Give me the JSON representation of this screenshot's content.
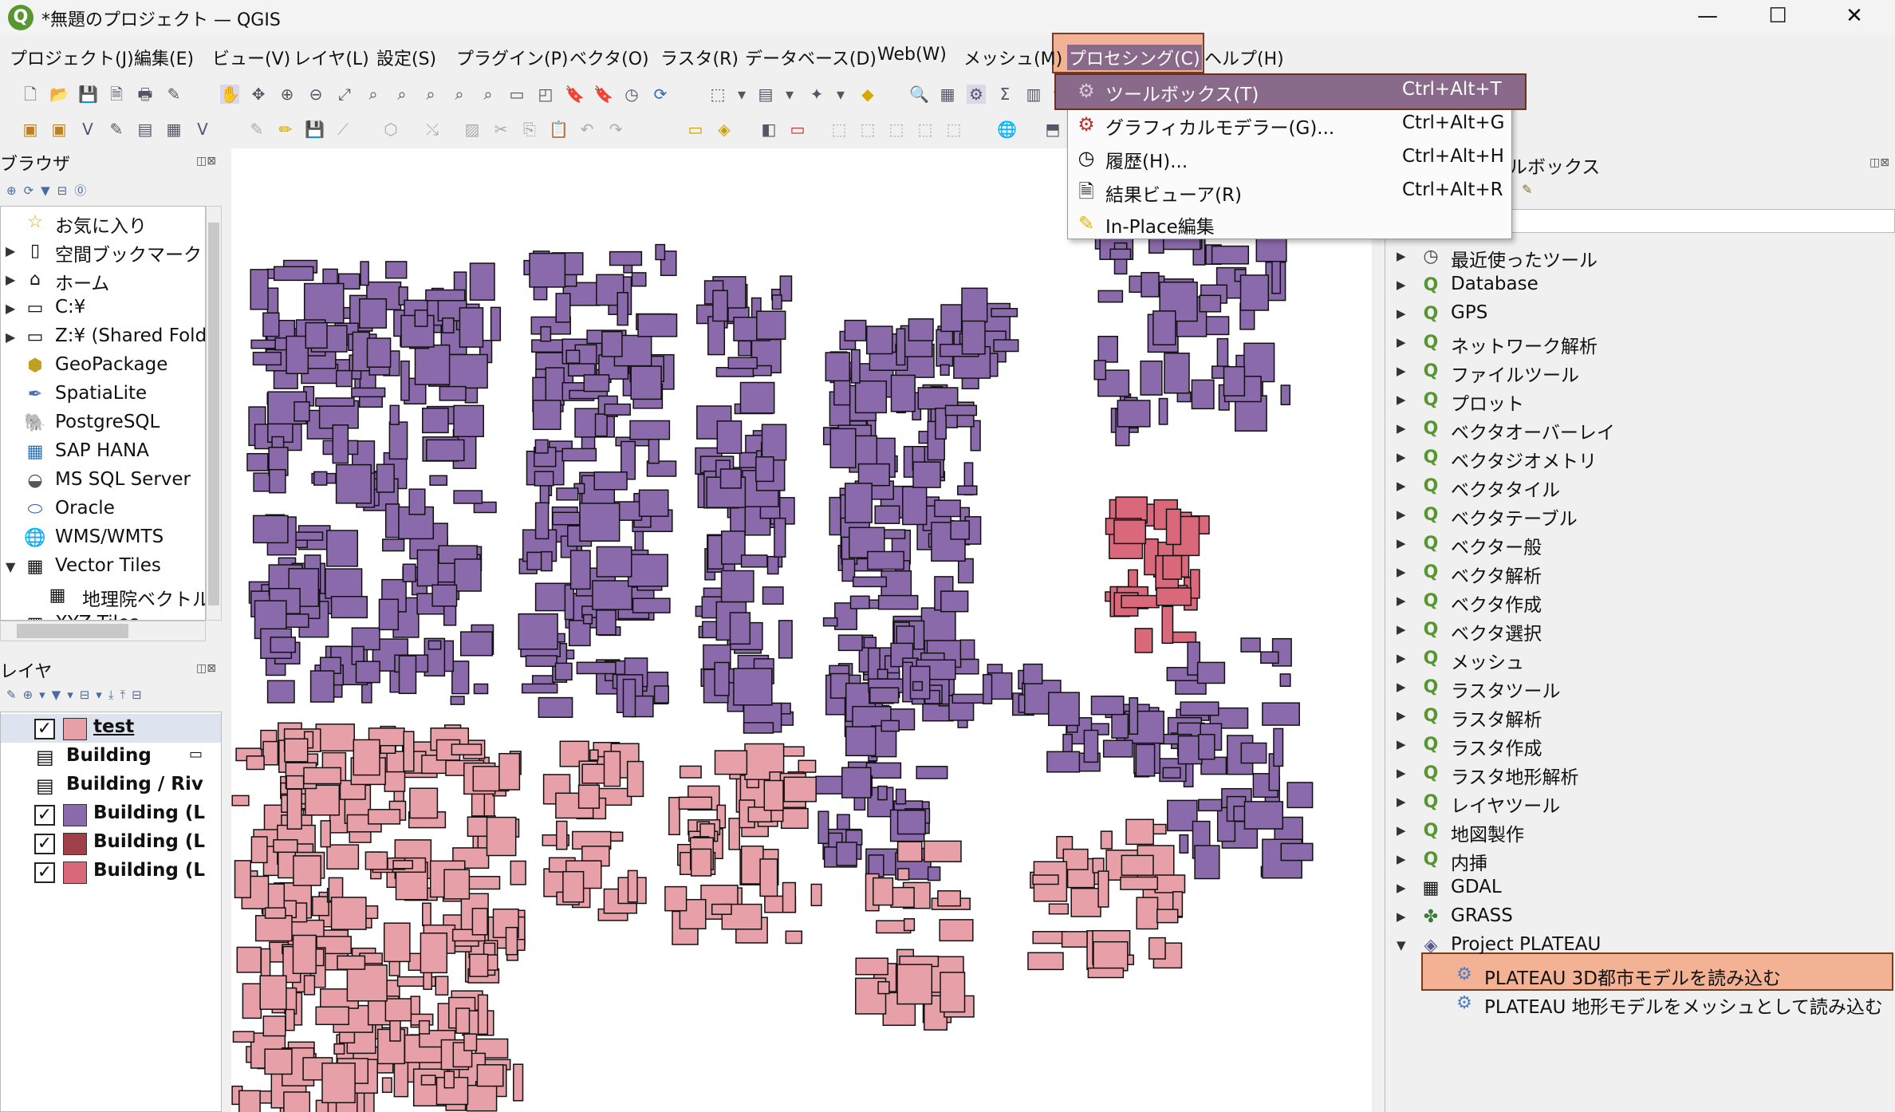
{
  "window": {
    "title": "*無題のプロジェクト — QGIS",
    "logo": "Q",
    "minimize_icon": "—",
    "maximize_icon": "☐",
    "close_icon": "✕"
  },
  "menu": [
    "プロジェクト(J)",
    "編集(E)",
    "ビュー(V)",
    "レイヤ(L)",
    "設定(S)",
    "プラグイン(P)",
    "ベクタ(O)",
    "ラスタ(R)",
    "データベース(D)",
    "Web(W)",
    "メッシュ(M)",
    "プロセシング(C)",
    "ヘルプ(H)"
  ],
  "processing_menu": {
    "items": [
      {
        "label": "ツールボックス(T)",
        "shortcut": "Ctrl+Alt+T",
        "icon": "gear-icon"
      },
      {
        "label": "グラフィカルモデラー(G)...",
        "shortcut": "Ctrl+Alt+G",
        "icon": "modeler-icon"
      },
      {
        "label": "履歴(H)...",
        "shortcut": "Ctrl+Alt+H",
        "icon": "history-icon"
      },
      {
        "label": "結果ビューア(R)",
        "shortcut": "Ctrl+Alt+R",
        "icon": "document-icon"
      },
      {
        "label": "In-Place編集",
        "shortcut": "",
        "icon": "pencil-icon"
      }
    ]
  },
  "browser": {
    "title": "ブラウザ",
    "items": [
      {
        "label": "お気に入り",
        "icon": "star-icon",
        "expand": ""
      },
      {
        "label": "空間ブックマーク",
        "icon": "bookmark-icon",
        "expand": "▶"
      },
      {
        "label": "ホーム",
        "icon": "home-icon",
        "expand": "▶"
      },
      {
        "label": "C:¥",
        "icon": "folder-icon",
        "expand": "▶"
      },
      {
        "label": "Z:¥ (Shared Fold",
        "icon": "folder-icon",
        "expand": "▶"
      },
      {
        "label": "GeoPackage",
        "icon": "geopackage-icon",
        "expand": ""
      },
      {
        "label": "SpatiaLite",
        "icon": "spatialite-icon",
        "expand": ""
      },
      {
        "label": "PostgreSQL",
        "icon": "postgresql-icon",
        "expand": ""
      },
      {
        "label": "SAP HANA",
        "icon": "saphana-icon",
        "expand": ""
      },
      {
        "label": "MS SQL Server",
        "icon": "mssql-icon",
        "expand": ""
      },
      {
        "label": "Oracle",
        "icon": "oracle-icon",
        "expand": ""
      },
      {
        "label": "WMS/WMTS",
        "icon": "globe-icon",
        "expand": ""
      },
      {
        "label": "Vector Tiles",
        "icon": "grid-icon",
        "expand": "▼"
      },
      {
        "label": "地理院ベクトル",
        "icon": "grid-icon",
        "expand": ""
      },
      {
        "label": "XYZ Tiles",
        "icon": "grid-icon",
        "expand": ""
      }
    ]
  },
  "layers": {
    "title": "レイヤ",
    "items": [
      {
        "label": "test",
        "checked": "✓",
        "color": "#e8a0a8"
      },
      {
        "label": "Building",
        "checked": "",
        "color": ""
      },
      {
        "label": "Building / Riv",
        "checked": "",
        "color": ""
      },
      {
        "label": "Building (L",
        "checked": "✓",
        "color": "#8a6aaa"
      },
      {
        "label": "Building (L",
        "checked": "✓",
        "color": "#a04048"
      },
      {
        "label": "Building (L",
        "checked": "✓",
        "color": "#d8687a"
      }
    ]
  },
  "toolbox": {
    "title": "ルボックス",
    "categories": [
      {
        "label": "最近使ったツール",
        "icon": "clock-icon"
      },
      {
        "label": "Database",
        "icon": "qgis-icon"
      },
      {
        "label": "GPS",
        "icon": "qgis-icon"
      },
      {
        "label": "ネットワーク解析",
        "icon": "qgis-icon"
      },
      {
        "label": "ファイルツール",
        "icon": "qgis-icon"
      },
      {
        "label": "プロット",
        "icon": "qgis-icon"
      },
      {
        "label": "ベクタオーバーレイ",
        "icon": "qgis-icon"
      },
      {
        "label": "ベクタジオメトリ",
        "icon": "qgis-icon"
      },
      {
        "label": "ベクタタイル",
        "icon": "qgis-icon"
      },
      {
        "label": "ベクタテーブル",
        "icon": "qgis-icon"
      },
      {
        "label": "ベクター般",
        "icon": "qgis-icon"
      },
      {
        "label": "ベクタ解析",
        "icon": "qgis-icon"
      },
      {
        "label": "ベクタ作成",
        "icon": "qgis-icon"
      },
      {
        "label": "ベクタ選択",
        "icon": "qgis-icon"
      },
      {
        "label": "メッシュ",
        "icon": "qgis-icon"
      },
      {
        "label": "ラスタツール",
        "icon": "qgis-icon"
      },
      {
        "label": "ラスタ解析",
        "icon": "qgis-icon"
      },
      {
        "label": "ラスタ作成",
        "icon": "qgis-icon"
      },
      {
        "label": "ラスタ地形解析",
        "icon": "qgis-icon"
      },
      {
        "label": "レイヤツール",
        "icon": "qgis-icon"
      },
      {
        "label": "地図製作",
        "icon": "qgis-icon"
      },
      {
        "label": "内挿",
        "icon": "qgis-icon"
      },
      {
        "label": "GDAL",
        "icon": "gdal-icon"
      },
      {
        "label": "GRASS",
        "icon": "grass-icon"
      },
      {
        "label": "Project PLATEAU",
        "icon": "plateau-icon"
      }
    ],
    "plateau_tools": [
      "PLATEAU 3D都市モデルを読み込む",
      "PLATEAU 地形モデルをメッシュとして読み込む"
    ]
  },
  "colors": {
    "purple_buildings": "#8a6aaa",
    "pink_buildings": "#e8a0a8",
    "red_buildings": "#d8687a",
    "highlight": "#f2b293",
    "menu_selected": "#8a6a8a"
  }
}
